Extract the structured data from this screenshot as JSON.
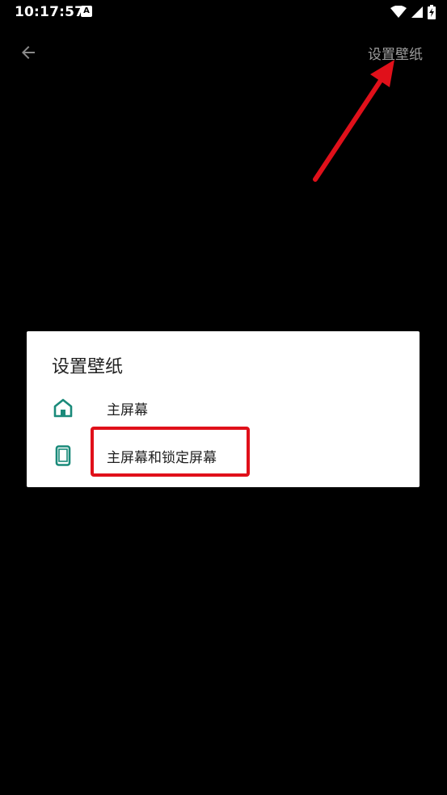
{
  "status_bar": {
    "time": "10:17:57",
    "notification_icon_letter": "A",
    "icons": [
      "wifi-icon",
      "signal-icon",
      "battery-charging-icon"
    ]
  },
  "toolbar": {
    "back_icon": "arrow-left-icon",
    "action_label": "设置壁纸"
  },
  "dialog": {
    "title": "设置壁纸",
    "options": [
      {
        "label": "主屏幕",
        "icon": "home-icon"
      },
      {
        "label": "主屏幕和锁定屏幕",
        "icon": "phone-icon"
      }
    ]
  },
  "colors": {
    "background": "#000000",
    "accent": "#1a8a7a",
    "annotation": "#e0101a",
    "dialog_bg": "#ffffff"
  }
}
